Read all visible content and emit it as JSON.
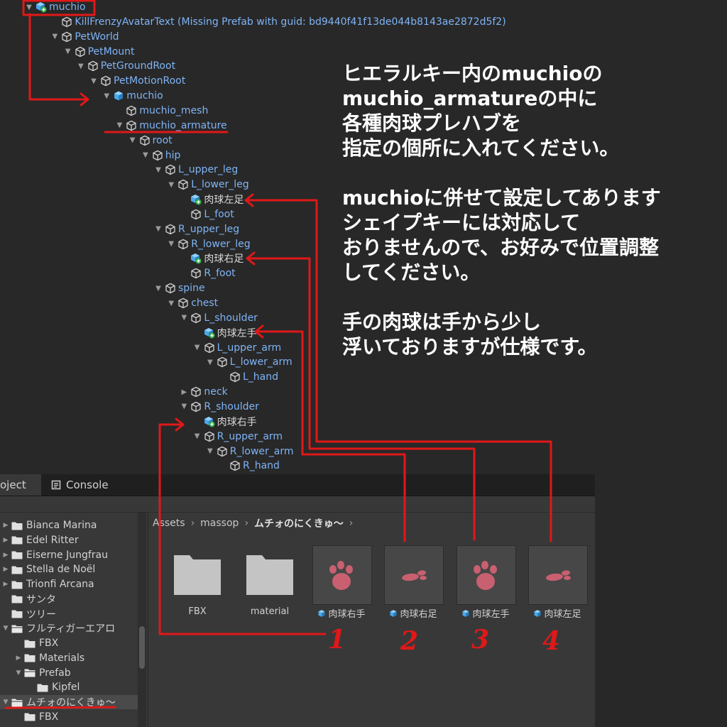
{
  "hierarchy": {
    "items": [
      {
        "label": "muchio",
        "arrow": "down",
        "icon": "prefab-variant-icon",
        "blue": true
      },
      {
        "label": "KillFrenzyAvatarText (Missing Prefab with guid: bd9440f41f13de044b8143ae2872d5f2)",
        "arrow": "",
        "icon": "gameobject-icon",
        "blue": true
      },
      {
        "label": "PetWorld",
        "arrow": "down",
        "icon": "gameobject-icon",
        "blue": true
      },
      {
        "label": "PetMount",
        "arrow": "down",
        "icon": "gameobject-icon",
        "blue": true
      },
      {
        "label": "PetGroundRoot",
        "arrow": "down",
        "icon": "gameobject-icon",
        "blue": true
      },
      {
        "label": "PetMotionRoot",
        "arrow": "down",
        "icon": "gameobject-icon",
        "blue": true
      },
      {
        "label": "muchio",
        "arrow": "down",
        "icon": "prefab-icon",
        "blue": true
      },
      {
        "label": "muchio_mesh",
        "arrow": "",
        "icon": "gameobject-icon",
        "blue": true
      },
      {
        "label": "muchio_armature",
        "arrow": "down",
        "icon": "gameobject-icon",
        "blue": true
      },
      {
        "label": "root",
        "arrow": "down",
        "icon": "gameobject-icon",
        "blue": true
      },
      {
        "label": "hip",
        "arrow": "down",
        "icon": "gameobject-icon",
        "blue": true
      },
      {
        "label": "L_upper_leg",
        "arrow": "down",
        "icon": "gameobject-icon",
        "blue": true
      },
      {
        "label": "L_lower_leg",
        "arrow": "down",
        "icon": "gameobject-icon",
        "blue": true
      },
      {
        "label": "肉球左足",
        "arrow": "",
        "icon": "prefab-variant-icon",
        "blue": false
      },
      {
        "label": "L_foot",
        "arrow": "",
        "icon": "gameobject-icon",
        "blue": true
      },
      {
        "label": "R_upper_leg",
        "arrow": "down",
        "icon": "gameobject-icon",
        "blue": true
      },
      {
        "label": "R_lower_leg",
        "arrow": "down",
        "icon": "gameobject-icon",
        "blue": true
      },
      {
        "label": "肉球右足",
        "arrow": "",
        "icon": "prefab-variant-icon",
        "blue": false
      },
      {
        "label": "R_foot",
        "arrow": "",
        "icon": "gameobject-icon",
        "blue": true
      },
      {
        "label": "spine",
        "arrow": "down",
        "icon": "gameobject-icon",
        "blue": true
      },
      {
        "label": "chest",
        "arrow": "down",
        "icon": "gameobject-icon",
        "blue": true
      },
      {
        "label": "L_shoulder",
        "arrow": "down",
        "icon": "gameobject-icon",
        "blue": true
      },
      {
        "label": "肉球左手",
        "arrow": "",
        "icon": "prefab-variant-icon",
        "blue": false
      },
      {
        "label": "L_upper_arm",
        "arrow": "down",
        "icon": "gameobject-icon",
        "blue": true
      },
      {
        "label": "L_lower_arm",
        "arrow": "down",
        "icon": "gameobject-icon",
        "blue": true
      },
      {
        "label": "L_hand",
        "arrow": "",
        "icon": "gameobject-icon",
        "blue": true
      },
      {
        "label": "neck",
        "arrow": "right",
        "icon": "gameobject-icon",
        "blue": true
      },
      {
        "label": "R_shoulder",
        "arrow": "down",
        "icon": "gameobject-icon",
        "blue": true
      },
      {
        "label": "肉球右手",
        "arrow": "",
        "icon": "prefab-variant-icon",
        "blue": false
      },
      {
        "label": "R_upper_arm",
        "arrow": "down",
        "icon": "gameobject-icon",
        "blue": true
      },
      {
        "label": "R_lower_arm",
        "arrow": "down",
        "icon": "gameobject-icon",
        "blue": true
      },
      {
        "label": "R_hand",
        "arrow": "",
        "icon": "gameobject-icon",
        "blue": true
      }
    ]
  },
  "note": {
    "paragraphs": [
      [
        "ヒエラルキー内のmuchioの",
        "muchio_armatureの中に",
        "各種肉球プレハブを",
        "指定の個所に入れてください。"
      ],
      [
        "muchioに併せて設定してあります",
        "シェイプキーには対応して",
        "おりませんので、お好みで位置調整",
        "してください。"
      ],
      [
        "手の肉球は手から少し",
        "浮いておりますが仕様です。"
      ]
    ]
  },
  "tabs": {
    "project": "oject",
    "console": "Console"
  },
  "project_tree": {
    "items": [
      {
        "label": "Bianca Marina",
        "arrow": "right",
        "open": false
      },
      {
        "label": "Edel Ritter",
        "arrow": "right",
        "open": false
      },
      {
        "label": "Eiserne Jungfrau",
        "arrow": "right",
        "open": false
      },
      {
        "label": "Stella de Noël",
        "arrow": "right",
        "open": false
      },
      {
        "label": "Trionfi Arcana",
        "arrow": "right",
        "open": false
      },
      {
        "label": "サンタ",
        "arrow": "",
        "open": false
      },
      {
        "label": "ツリー",
        "arrow": "",
        "open": false
      },
      {
        "label": "フルティガーエアロ",
        "arrow": "down",
        "open": true
      },
      {
        "label": "FBX",
        "arrow": "",
        "open": false
      },
      {
        "label": "Materials",
        "arrow": "right",
        "open": false
      },
      {
        "label": "Prefab",
        "arrow": "down",
        "open": true
      },
      {
        "label": "Kipfel",
        "arrow": "",
        "open": false
      },
      {
        "label": "ムチォのにくきゅ〜",
        "arrow": "down",
        "open": true,
        "selected": true
      },
      {
        "label": "FBX",
        "arrow": "",
        "open": false
      }
    ]
  },
  "breadcrumb": [
    "Assets",
    "massop",
    "ムチォのにくきゅ〜"
  ],
  "assets": [
    {
      "name": "FBX",
      "type": "folder"
    },
    {
      "name": "material",
      "type": "folder"
    },
    {
      "name": "肉球右手",
      "type": "prefab",
      "paw": "full"
    },
    {
      "name": "肉球右足",
      "type": "prefab",
      "paw": "foot"
    },
    {
      "name": "肉球左手",
      "type": "prefab",
      "paw": "full"
    },
    {
      "name": "肉球左足",
      "type": "prefab",
      "paw": "foot"
    }
  ],
  "annotations": {
    "numbers": [
      "1",
      "2",
      "3",
      "4"
    ],
    "color": "#e01818"
  },
  "colors": {
    "background": "#282828",
    "hierarchy_label": "#7fb4f6",
    "paw_pink": "#c86070"
  }
}
